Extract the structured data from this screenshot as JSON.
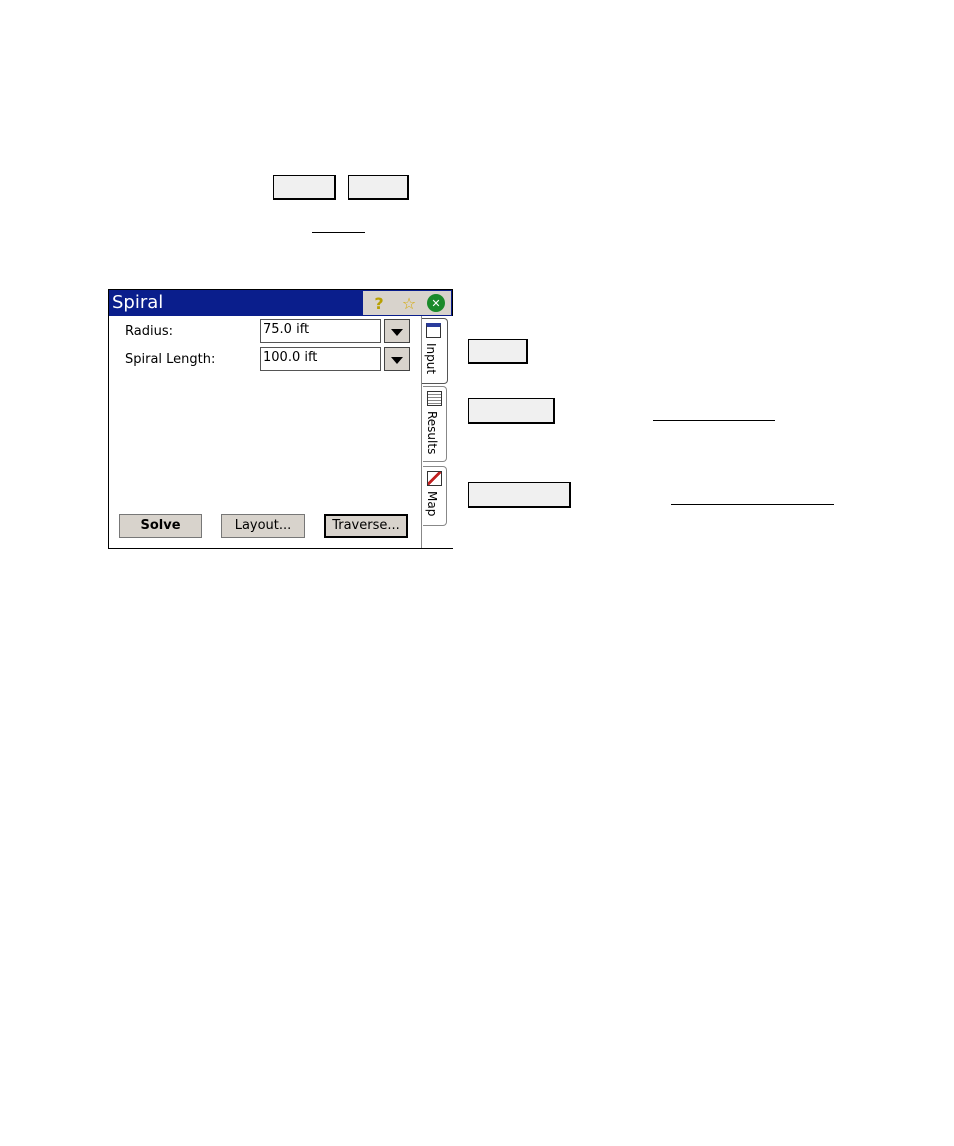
{
  "window": {
    "title": "Spiral",
    "help_icon": "?",
    "star_icon": "☆",
    "close_icon": "✕"
  },
  "fields": [
    {
      "label": "Radius:",
      "value": "75.0 ift"
    },
    {
      "label": "Spiral Length:",
      "value": "100.0 ift"
    }
  ],
  "buttons": {
    "solve": "Solve",
    "layout": "Layout...",
    "traverse": "Traverse..."
  },
  "tabs": [
    "Input",
    "Results",
    "Map"
  ],
  "colors": {
    "titlebar": "#0a1e8c",
    "button_face": "#d8d3cc"
  }
}
